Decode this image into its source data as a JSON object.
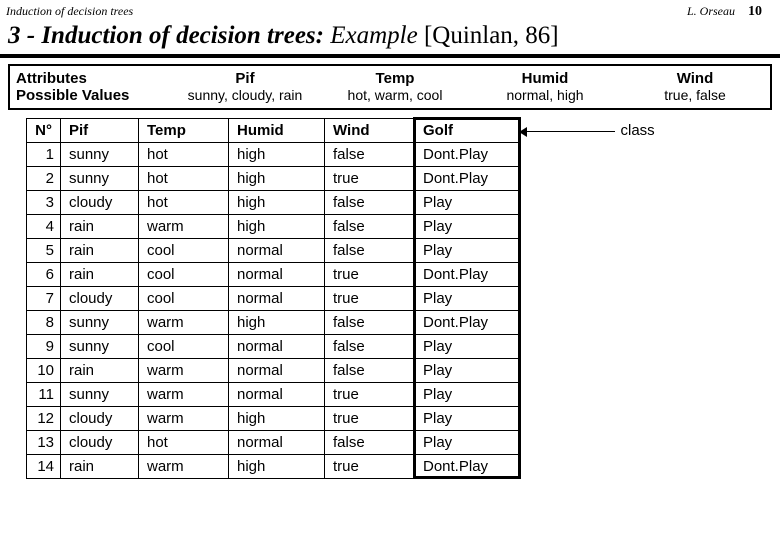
{
  "header": {
    "doc_title": "Induction of decision trees",
    "author": "L. Orseau",
    "page_number": "10"
  },
  "title": {
    "section": "3 - Induction of decision trees:",
    "example": " Example ",
    "citation": "[Quinlan, 86]"
  },
  "attributes": {
    "label1": "Attributes",
    "label2": "Possible Values",
    "cols": [
      {
        "name": "Pif",
        "values": "sunny, cloudy, rain"
      },
      {
        "name": "Temp",
        "values": "hot, warm, cool"
      },
      {
        "name": "Humid",
        "values": "normal, high"
      },
      {
        "name": "Wind",
        "values": "true, false"
      }
    ]
  },
  "class_label": "class",
  "table": {
    "headers": [
      "N°",
      "Pif",
      "Temp",
      "Humid",
      "Wind",
      "Golf"
    ],
    "rows": [
      [
        "1",
        "sunny",
        "hot",
        "high",
        "false",
        "Dont.Play"
      ],
      [
        "2",
        "sunny",
        "hot",
        "high",
        "true",
        "Dont.Play"
      ],
      [
        "3",
        "cloudy",
        "hot",
        "high",
        "false",
        "Play"
      ],
      [
        "4",
        "rain",
        "warm",
        "high",
        "false",
        "Play"
      ],
      [
        "5",
        "rain",
        "cool",
        "normal",
        "false",
        "Play"
      ],
      [
        "6",
        "rain",
        "cool",
        "normal",
        "true",
        "Dont.Play"
      ],
      [
        "7",
        "cloudy",
        "cool",
        "normal",
        "true",
        "Play"
      ],
      [
        "8",
        "sunny",
        "warm",
        "high",
        "false",
        "Dont.Play"
      ],
      [
        "9",
        "sunny",
        "cool",
        "normal",
        "false",
        "Play"
      ],
      [
        "10",
        "rain",
        "warm",
        "normal",
        "false",
        "Play"
      ],
      [
        "11",
        "sunny",
        "warm",
        "normal",
        "true",
        "Play"
      ],
      [
        "12",
        "cloudy",
        "warm",
        "high",
        "true",
        "Play"
      ],
      [
        "13",
        "cloudy",
        "hot",
        "normal",
        "false",
        "Play"
      ],
      [
        "14",
        "rain",
        "warm",
        "high",
        "true",
        "Dont.Play"
      ]
    ]
  }
}
